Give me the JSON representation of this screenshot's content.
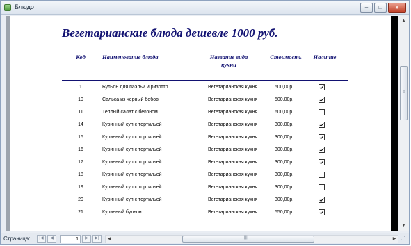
{
  "window": {
    "title": "Блюдо",
    "minimize": "–",
    "maximize": "□",
    "close": "x"
  },
  "report": {
    "title": "Вегетарианские блюда дешевле 1000 руб.",
    "headers": {
      "code": "Код",
      "name": "Наименование блюда",
      "kind": "Название вида кухни",
      "cost": "Стоимость",
      "available": "Наличие"
    },
    "rows": [
      {
        "code": "1",
        "name": "Бульон для паэльи и ризотто",
        "kind": "Вегетарианская кухня",
        "cost": "500,00р.",
        "available": true
      },
      {
        "code": "10",
        "name": "Сальса из черный бобов",
        "kind": "Вегетарианская кухня",
        "cost": "500,00р.",
        "available": true
      },
      {
        "code": "11",
        "name": "Теплый салат с беконом",
        "kind": "Вегетарианская кухня",
        "cost": "600,00р.",
        "available": false
      },
      {
        "code": "14",
        "name": "Куринный суп с тортильей",
        "kind": "Вегетарианская кухня",
        "cost": "300,00р.",
        "available": true
      },
      {
        "code": "15",
        "name": "Куринный суп с тортильей",
        "kind": "Вегетарианская кухня",
        "cost": "300,00р.",
        "available": true
      },
      {
        "code": "16",
        "name": "Куринный суп с тортильей",
        "kind": "Вегетарианская кухня",
        "cost": "300,00р.",
        "available": true
      },
      {
        "code": "17",
        "name": "Куринный суп с тортильей",
        "kind": "Вегетарианская кухня",
        "cost": "300,00р.",
        "available": true
      },
      {
        "code": "18",
        "name": "Куринный суп с тортильей",
        "kind": "Вегетарианская кухня",
        "cost": "300,00р.",
        "available": false
      },
      {
        "code": "19",
        "name": "Куринный суп с тортильей",
        "kind": "Вегетарианская кухня",
        "cost": "300,00р.",
        "available": false
      },
      {
        "code": "20",
        "name": "Куринный суп с тортильей",
        "kind": "Вегетарианская кухня",
        "cost": "300,00р.",
        "available": true
      },
      {
        "code": "21",
        "name": "Куринный бульон",
        "kind": "Вегетарианская кухня",
        "cost": "550,00р.",
        "available": true
      }
    ]
  },
  "statusbar": {
    "page_label": "Страница:",
    "page_value": "1",
    "nav": {
      "first": "|◀",
      "prev": "◀",
      "next": "▶",
      "last": "▶|"
    }
  },
  "scroll": {
    "up": "▲",
    "down": "▼",
    "left": "◀",
    "right": "▶",
    "grip_v": "≡",
    "grip_h": "|||"
  }
}
